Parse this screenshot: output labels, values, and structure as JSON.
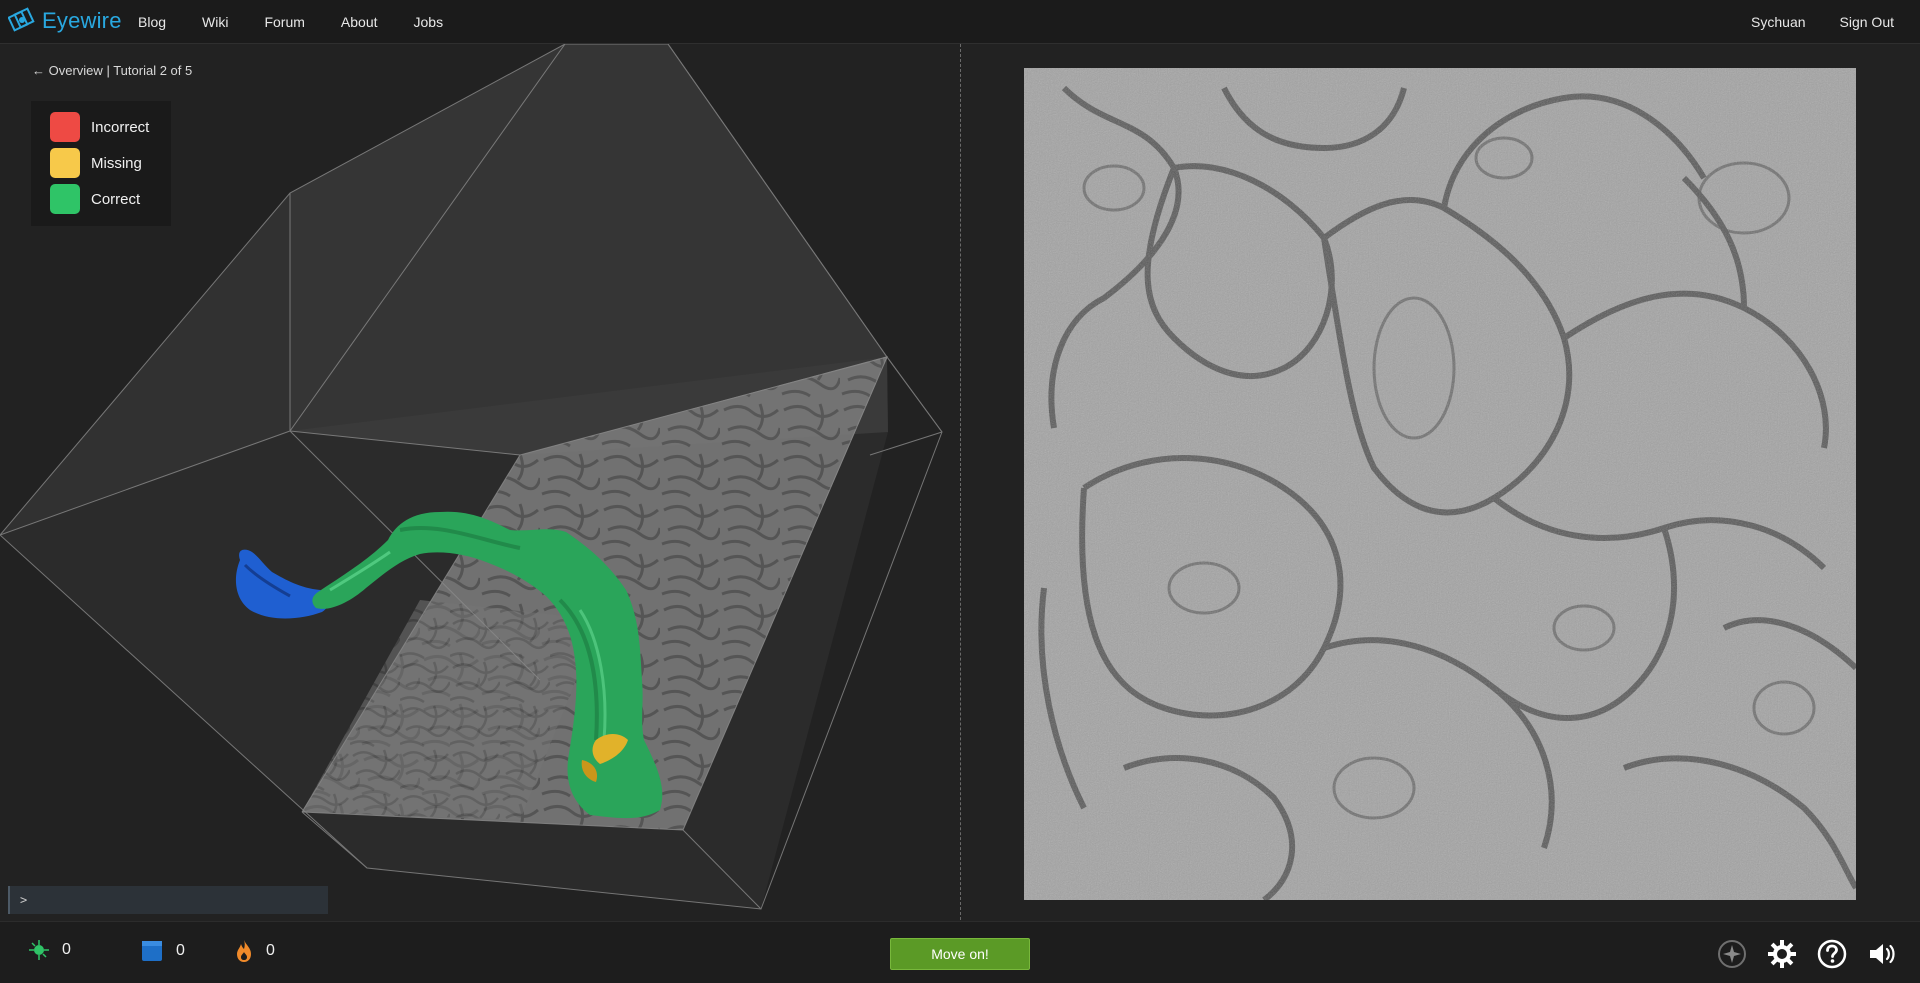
{
  "brand": {
    "name": "Eyewire",
    "accent": "#29a8e0"
  },
  "nav": {
    "items": [
      "Blog",
      "Wiki",
      "Forum",
      "About",
      "Jobs"
    ],
    "user": "Sychuan",
    "sign_out": "Sign Out"
  },
  "tutorial": {
    "back_arrow": "←",
    "overview": "Overview",
    "separator": "|",
    "progress": "Tutorial 2 of 5"
  },
  "legend": [
    {
      "label": "Incorrect",
      "color": "#ee4a44"
    },
    {
      "label": "Missing",
      "color": "#f7c94a"
    },
    {
      "label": "Correct",
      "color": "#2fc467"
    }
  ],
  "console": {
    "prompt": ">"
  },
  "stats": {
    "points": "0",
    "cubes": "0",
    "streak": "0"
  },
  "actions": {
    "move_on": "Move on!"
  },
  "icons": {
    "logo": "eyewire-logo-icon",
    "points": "neuron-points-icon",
    "cubes": "cube-icon",
    "streak": "flame-icon",
    "tools": [
      "compass-icon",
      "gear-icon",
      "help-icon",
      "volume-icon"
    ]
  },
  "colors": {
    "segment_blue": "#1f5fd1",
    "segment_green": "#2aa55a",
    "segment_yellow": "#e1b22a"
  }
}
